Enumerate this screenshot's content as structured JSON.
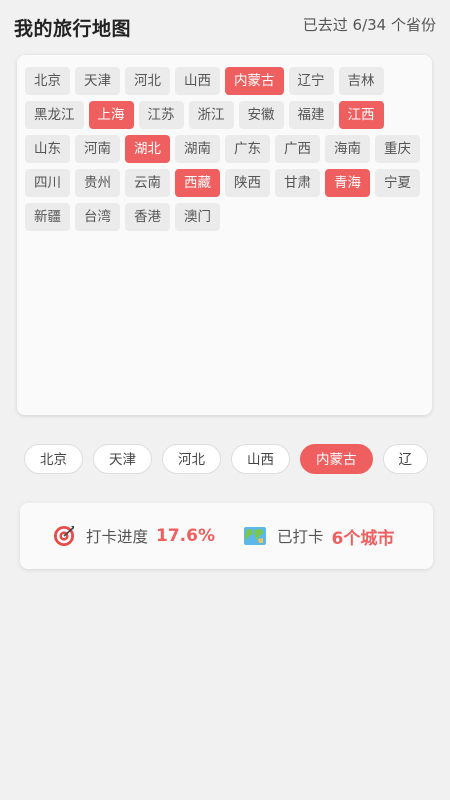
{
  "header": {
    "title": "我的旅行地图",
    "visited_count": "已去过 6/34 个省份"
  },
  "provinces": [
    {
      "name": "北京",
      "visited": false
    },
    {
      "name": "天津",
      "visited": false
    },
    {
      "name": "河北",
      "visited": false
    },
    {
      "name": "山西",
      "visited": false
    },
    {
      "name": "内蒙古",
      "visited": true
    },
    {
      "name": "辽宁",
      "visited": false
    },
    {
      "name": "吉林",
      "visited": false
    },
    {
      "name": "黑龙江",
      "visited": false
    },
    {
      "name": "上海",
      "visited": true
    },
    {
      "name": "江苏",
      "visited": false
    },
    {
      "name": "浙江",
      "visited": false
    },
    {
      "name": "安徽",
      "visited": false
    },
    {
      "name": "福建",
      "visited": false
    },
    {
      "name": "江西",
      "visited": true
    },
    {
      "name": "山东",
      "visited": false
    },
    {
      "name": "河南",
      "visited": false
    },
    {
      "name": "湖北",
      "visited": true
    },
    {
      "name": "湖南",
      "visited": false
    },
    {
      "name": "广东",
      "visited": false
    },
    {
      "name": "广西",
      "visited": false
    },
    {
      "name": "海南",
      "visited": false
    },
    {
      "name": "重庆",
      "visited": false
    },
    {
      "name": "四川",
      "visited": false
    },
    {
      "name": "贵州",
      "visited": false
    },
    {
      "name": "云南",
      "visited": false
    },
    {
      "name": "西藏",
      "visited": true
    },
    {
      "name": "陕西",
      "visited": false
    },
    {
      "name": "甘肃",
      "visited": false
    },
    {
      "name": "青海",
      "visited": true
    },
    {
      "name": "宁夏",
      "visited": false
    },
    {
      "name": "新疆",
      "visited": false
    },
    {
      "name": "台湾",
      "visited": false
    },
    {
      "name": "香港",
      "visited": false
    },
    {
      "name": "澳门",
      "visited": false
    }
  ],
  "chips": [
    {
      "name": "北京",
      "active": false
    },
    {
      "name": "天津",
      "active": false
    },
    {
      "name": "河北",
      "active": false
    },
    {
      "name": "山西",
      "active": false
    },
    {
      "name": "内蒙古",
      "active": true
    },
    {
      "name": "辽",
      "active": false
    }
  ],
  "stats": {
    "progress_icon": "target-icon",
    "progress_label": "打卡进度",
    "progress_value": "17.6%",
    "map_icon": "world-map-icon",
    "visited_label": "已打卡",
    "visited_value": "6个城市"
  },
  "colors": {
    "accent": "#f05f5f",
    "background": "#f1f1f1",
    "tag_default": "#ebebeb"
  }
}
